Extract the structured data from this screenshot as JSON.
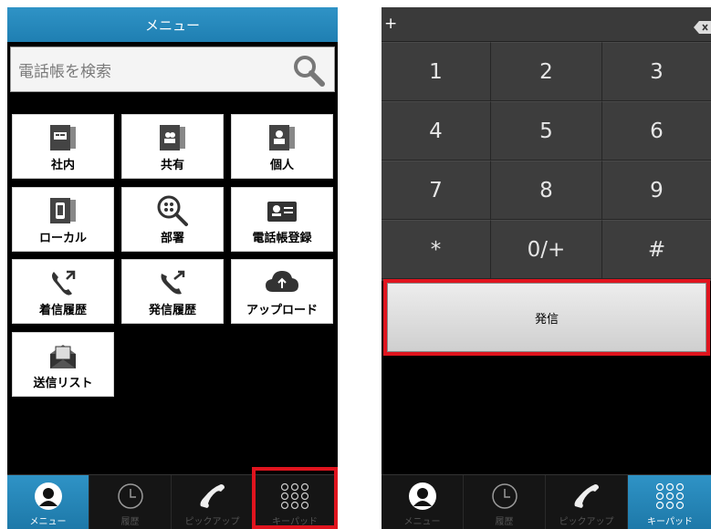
{
  "left": {
    "header_title": "メニュー",
    "search_placeholder": "電話帳を検索",
    "tiles": [
      {
        "label": "社内",
        "icon": "company-directory-icon"
      },
      {
        "label": "共有",
        "icon": "shared-contacts-icon"
      },
      {
        "label": "個人",
        "icon": "personal-contacts-icon"
      },
      {
        "label": "ローカル",
        "icon": "local-phone-icon"
      },
      {
        "label": "部署",
        "icon": "department-search-icon"
      },
      {
        "label": "電話帳登録",
        "icon": "add-contact-icon"
      },
      {
        "label": "着信履歴",
        "icon": "incoming-call-icon"
      },
      {
        "label": "発信履歴",
        "icon": "outgoing-call-icon"
      },
      {
        "label": "アップロード",
        "icon": "cloud-upload-icon"
      },
      {
        "label": "送信リスト",
        "icon": "send-list-icon"
      }
    ],
    "active_tab": "keypad",
    "highlighted_tab": "keypad"
  },
  "nav": {
    "menu": "メニュー",
    "history": "履歴",
    "pickup": "ピックアップ",
    "keypad": "キーパッド"
  },
  "right": {
    "dial_input": "+",
    "keys": [
      "1",
      "2",
      "3",
      "4",
      "5",
      "6",
      "7",
      "8",
      "9",
      "*",
      "0/+",
      "#"
    ],
    "call_button": "発信",
    "active_tab": "keypad"
  },
  "colors": {
    "accent": "#2a8cc0",
    "highlight": "#e0141e"
  }
}
